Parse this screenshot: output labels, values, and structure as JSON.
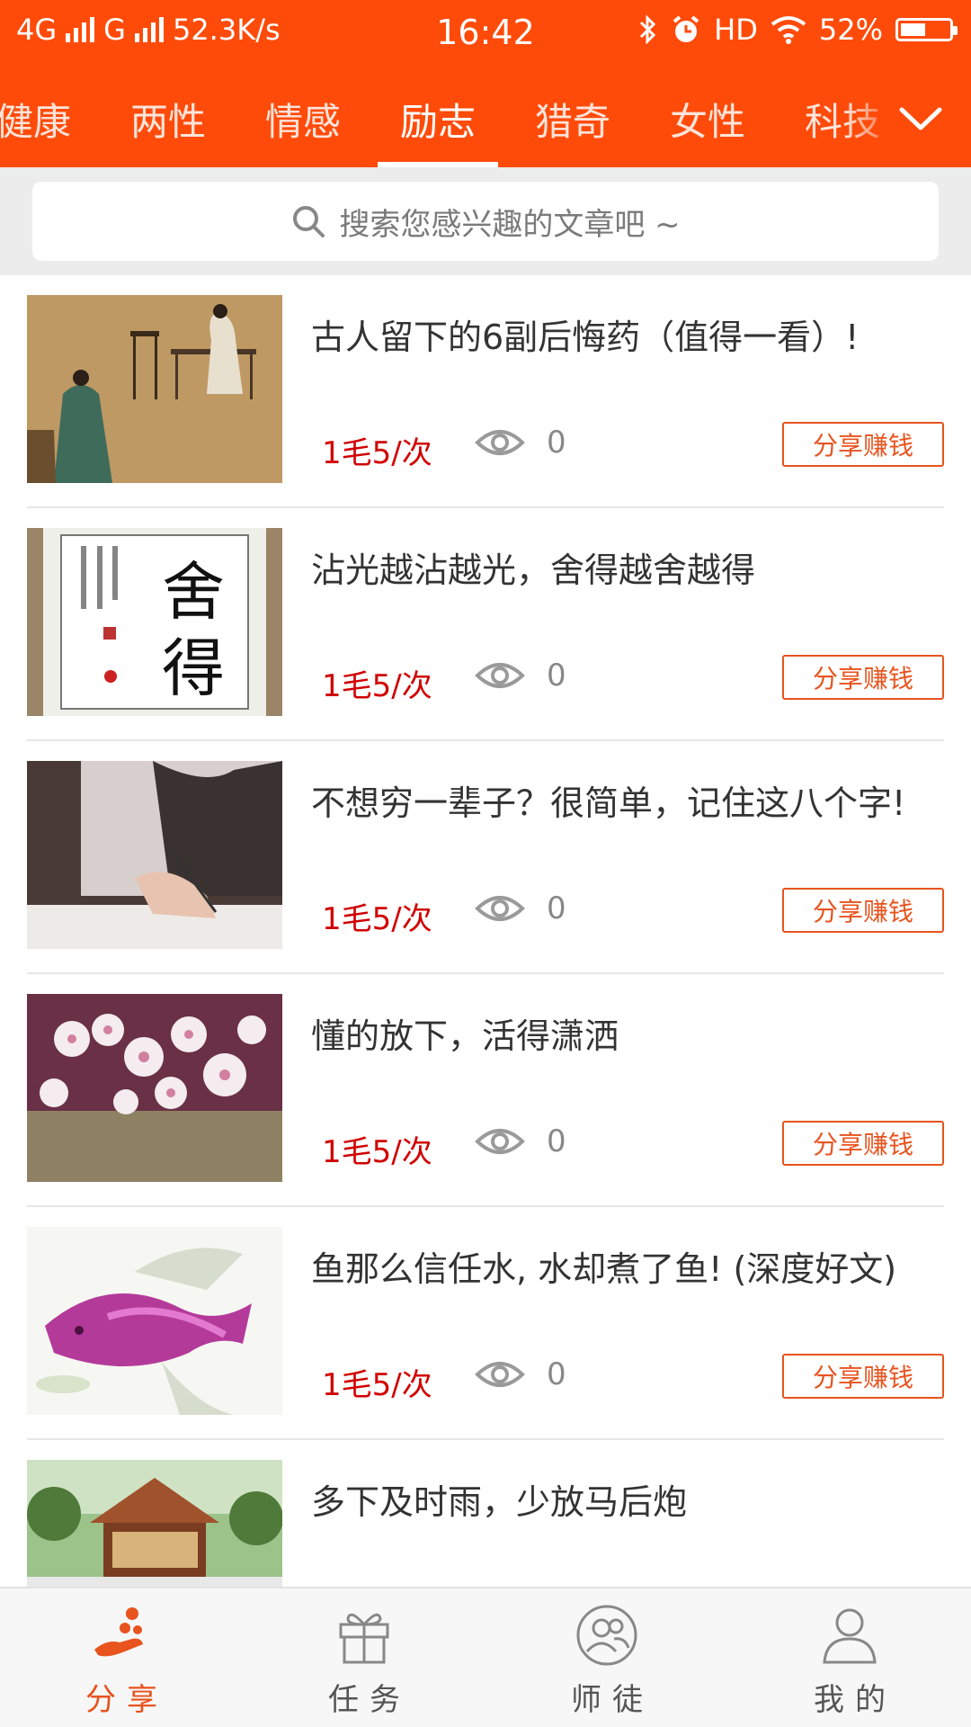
{
  "status_bar": {
    "network": "4G",
    "network2": "G",
    "speed": "52.3K/s",
    "time": "16:42",
    "hd": "HD",
    "battery_text": "52%",
    "battery_level": 0.52
  },
  "categories": [
    "健康",
    "两性",
    "情感",
    "励志",
    "猎奇",
    "女性",
    "科技"
  ],
  "active_category": "励志",
  "search": {
    "placeholder": "搜索您感兴趣的文章吧 ~"
  },
  "articles": [
    {
      "title": "古人留下的6副后悔药（值得一看）!",
      "price": "1毛5/次",
      "views": "0",
      "share_label": "分享赚钱"
    },
    {
      "title": "沾光越沾越光，舍得越舍越得",
      "price": "1毛5/次",
      "views": "0",
      "share_label": "分享赚钱"
    },
    {
      "title": "不想穷一辈子？很简单，记住这八个字!",
      "price": "1毛5/次",
      "views": "0",
      "share_label": "分享赚钱"
    },
    {
      "title": "懂的放下，活得潇洒",
      "price": "1毛5/次",
      "views": "0",
      "share_label": "分享赚钱"
    },
    {
      "title": "鱼那么信任水, 水却煮了鱼! (深度好文)",
      "price": "1毛5/次",
      "views": "0",
      "share_label": "分享赚钱"
    },
    {
      "title": "多下及时雨，少放马后炮"
    }
  ],
  "bottom_nav": [
    {
      "label": "分享",
      "icon": "share-hand-icon",
      "active": true
    },
    {
      "label": "任务",
      "icon": "gift-icon",
      "active": false
    },
    {
      "label": "师徒",
      "icon": "group-icon",
      "active": false
    },
    {
      "label": "我的",
      "icon": "user-icon",
      "active": false
    }
  ],
  "colors": {
    "brand": "#FF4B0A",
    "price": "#D10000",
    "accent": "#E8531E"
  }
}
